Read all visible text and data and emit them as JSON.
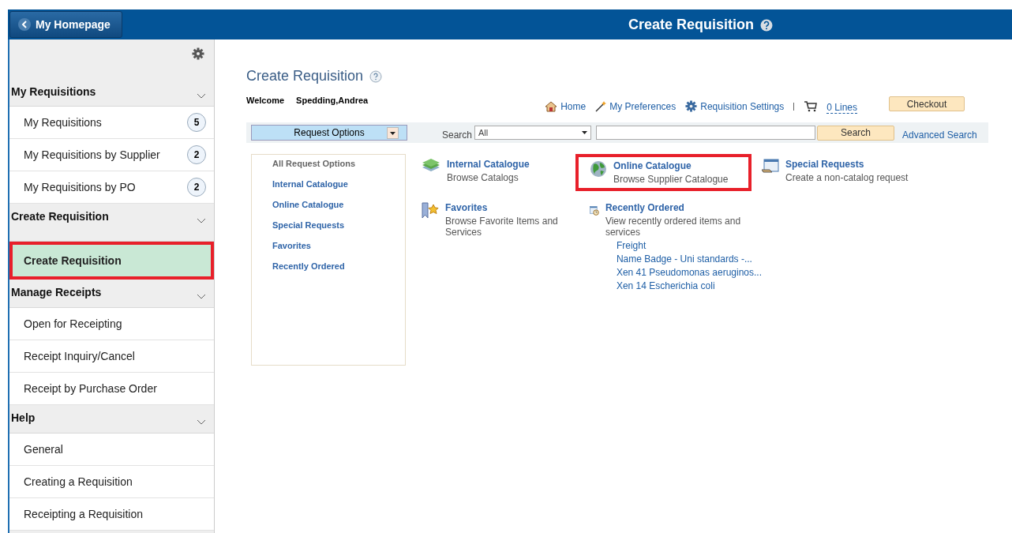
{
  "header": {
    "back_button": "My Homepage",
    "title": "Create Requisition"
  },
  "sidebar": {
    "sections": [
      {
        "title": "My Requisitions",
        "expanded": true,
        "items": [
          {
            "label": "My Requisitions",
            "count": "5",
            "selected": false,
            "highlighted": false
          },
          {
            "label": "My Requisitions by Supplier",
            "count": "2",
            "selected": false,
            "highlighted": false
          },
          {
            "label": "My Requisitions by PO",
            "count": "2",
            "selected": false,
            "highlighted": false
          }
        ]
      },
      {
        "title": "Create Requisition",
        "expanded": true,
        "items": [
          {
            "label": "Create Requisition",
            "selected": true,
            "highlighted": true
          }
        ]
      },
      {
        "title": "Manage Receipts",
        "expanded": true,
        "items": [
          {
            "label": "Open for Receipting",
            "selected": false,
            "highlighted": false
          },
          {
            "label": "Receipt Inquiry/Cancel",
            "selected": false,
            "highlighted": false
          },
          {
            "label": "Receipt by Purchase Order",
            "selected": false,
            "highlighted": false
          }
        ]
      },
      {
        "title": "Help",
        "expanded": true,
        "items": [
          {
            "label": "General",
            "selected": false,
            "highlighted": false
          },
          {
            "label": "Creating a Requisition",
            "selected": false,
            "highlighted": false
          },
          {
            "label": "Receipting a Requisition",
            "selected": false,
            "highlighted": false
          }
        ]
      }
    ]
  },
  "page": {
    "title": "Create Requisition",
    "welcome_label": "Welcome",
    "user_name": "Spedding,Andrea",
    "links": [
      {
        "kind": "home",
        "label": "Home"
      },
      {
        "kind": "wand",
        "label": "My Preferences"
      },
      {
        "kind": "gear",
        "label": "Requisition Settings"
      }
    ],
    "cart_link": "0 Lines",
    "checkout_button": "Checkout",
    "request_options": "Request Options",
    "search_label": "Search",
    "search_scope": "All",
    "search_button": "Search",
    "advanced_search": "Advanced Search",
    "options_menu": [
      {
        "label": "All Request Options",
        "selected": true
      },
      {
        "label": "Internal Catalogue",
        "selected": false
      },
      {
        "label": "Online Catalogue",
        "selected": false
      },
      {
        "label": "Special Requests",
        "selected": false
      },
      {
        "label": "Favorites",
        "selected": false
      },
      {
        "label": "Recently Ordered",
        "selected": false
      }
    ],
    "tiles": [
      {
        "kind": "books",
        "title": "Internal Catalogue",
        "description": "Browse Catalogs",
        "highlighted": false
      },
      {
        "kind": "globe",
        "title": "Online Catalogue",
        "description": "Browse Supplier Catalogue",
        "highlighted": true
      },
      {
        "kind": "form",
        "title": "Special Requests",
        "description": "Create a non-catalog request",
        "highlighted": false
      },
      {
        "kind": "bookmark",
        "title": "Favorites",
        "description": "Browse Favorite Items and Services",
        "highlighted": false
      },
      {
        "kind": "clock",
        "title": "Recently Ordered",
        "description": "View recently ordered items and services",
        "highlighted": false,
        "recent_items": [
          "Freight",
          "Name Badge - Uni standards -...",
          "Xen 41 Pseudomonas aeruginos...",
          "Xen 14 Escherichia coli"
        ]
      }
    ]
  }
}
